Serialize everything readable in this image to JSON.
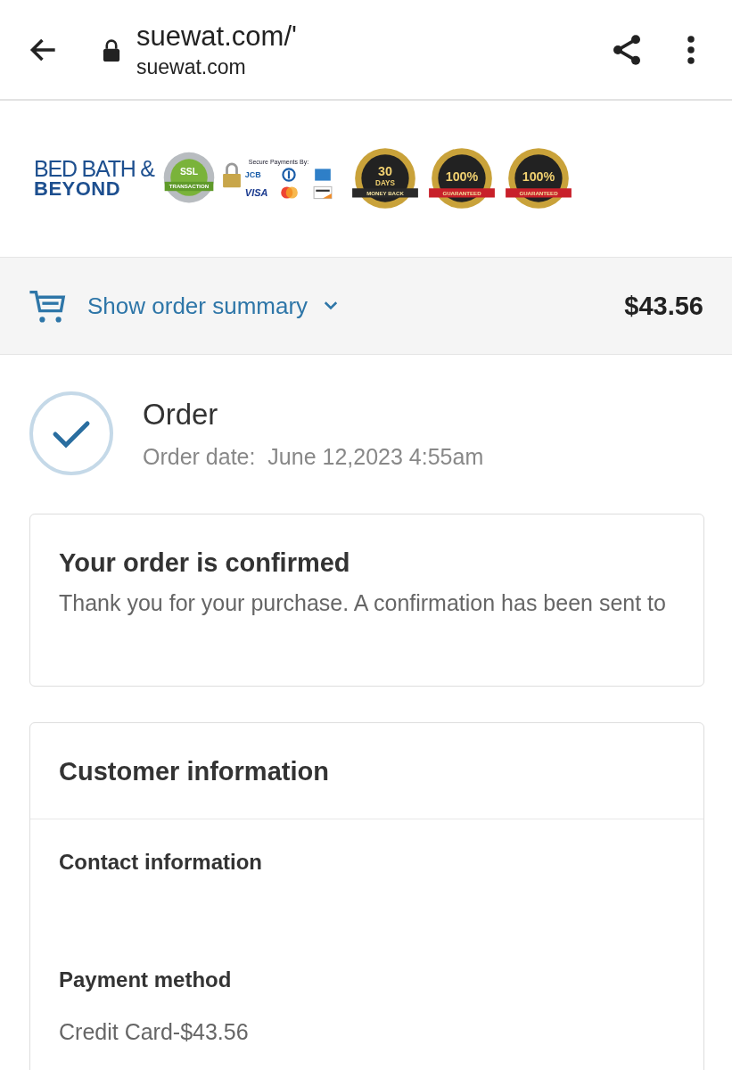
{
  "browser": {
    "url": "suewat.com/'",
    "domain": "suewat.com"
  },
  "brand": {
    "line1": "BED BATH &",
    "line2": "BEYOND"
  },
  "badges": [
    {
      "kind": "ssl",
      "title": "SSL",
      "ribbon": "TRANSACTION"
    },
    {
      "kind": "payments",
      "heading": "Secure Payments By:",
      "cards": [
        {
          "kind": "jcb",
          "label": "JCB"
        },
        {
          "kind": "diners"
        },
        {
          "kind": "amex"
        },
        {
          "kind": "visa",
          "label": "VISA"
        },
        {
          "kind": "mastercard"
        },
        {
          "kind": "discover"
        }
      ]
    },
    {
      "kind": "seal-dark",
      "big": "30",
      "small": "DAYS",
      "ribbon": "MONEY BACK"
    },
    {
      "kind": "seal-red",
      "big": "100%",
      "ribbon": "GUARANTEED"
    },
    {
      "kind": "seal-red",
      "big": "100%",
      "ribbon": "GUARANTEED"
    }
  ],
  "summary": {
    "label": "Show order summary",
    "total": "$43.56",
    "expanded": false
  },
  "order": {
    "title": "Order",
    "date_label": "Order date:",
    "date": "June 12,2023 4:55am",
    "confirmed": true
  },
  "confirmation": {
    "title": "Your order is confirmed",
    "text": "Thank you for your purchase. A confirmation has been sent to"
  },
  "customer": {
    "title": "Customer information",
    "sections": [
      {
        "heading": "Contact information"
      },
      {
        "heading": "Payment method",
        "value": "Credit Card-$43.56"
      }
    ]
  }
}
